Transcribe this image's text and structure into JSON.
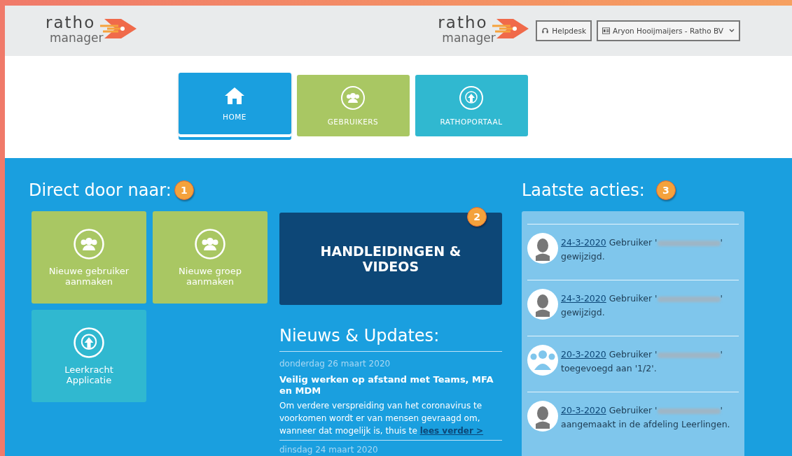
{
  "header": {
    "logos": [
      {
        "word1": "ratho",
        "word2": "manager"
      },
      {
        "word1": "ratho",
        "word2": "manager"
      }
    ],
    "helpdesk": "Helpdesk",
    "account": "Aryon Hooijmaijers - Ratho BV"
  },
  "tabs": [
    {
      "label": "HOME",
      "kind": "home",
      "selected": true
    },
    {
      "label": "GEBRUIKERS",
      "kind": "users",
      "selected": false
    },
    {
      "label": "RATHOPORTAAL",
      "kind": "portal",
      "selected": false
    }
  ],
  "shortcuts": {
    "title": "Direct door naar:",
    "badge": "1",
    "tiles": [
      {
        "label": "Nieuwe gebruiker aanmaken",
        "kind": "users"
      },
      {
        "label": "Nieuwe groep aanmaken",
        "kind": "users"
      },
      {
        "label": "Leerkracht Applicatie",
        "kind": "portal"
      }
    ]
  },
  "manuals": {
    "label": "HANDLEIDINGEN & VIDEOS",
    "badge": "2"
  },
  "news": {
    "title": "Nieuws & Updates:",
    "items": [
      {
        "date": "donderdag 26 maart 2020",
        "title": "Veilig werken op afstand met Teams, MFA en MDM",
        "body": "Om verdere verspreiding van het coronavirus te voorkomen wordt er van mensen gevraagd om, wanneer dat mogelijk is, thuis te",
        "link": "lees verder >"
      },
      {
        "date": "dinsdag 24 maart 2020"
      }
    ]
  },
  "actions": {
    "title": "Laatste acties:",
    "badge": "3",
    "items": [
      {
        "kind": "person",
        "date": "24-3-2020",
        "before": "Gebruiker '",
        "after": "' gewijzigd."
      },
      {
        "kind": "person",
        "date": "24-3-2020",
        "before": "Gebruiker '",
        "after": "' gewijzigd."
      },
      {
        "kind": "group",
        "date": "20-3-2020",
        "before": "Gebruiker '",
        "after": "' toegevoegd aan '1/2'."
      },
      {
        "kind": "person",
        "date": "20-3-2020",
        "before": "Gebruiker '",
        "after": "' aangemaakt in de afdeling Leerlingen."
      }
    ]
  }
}
